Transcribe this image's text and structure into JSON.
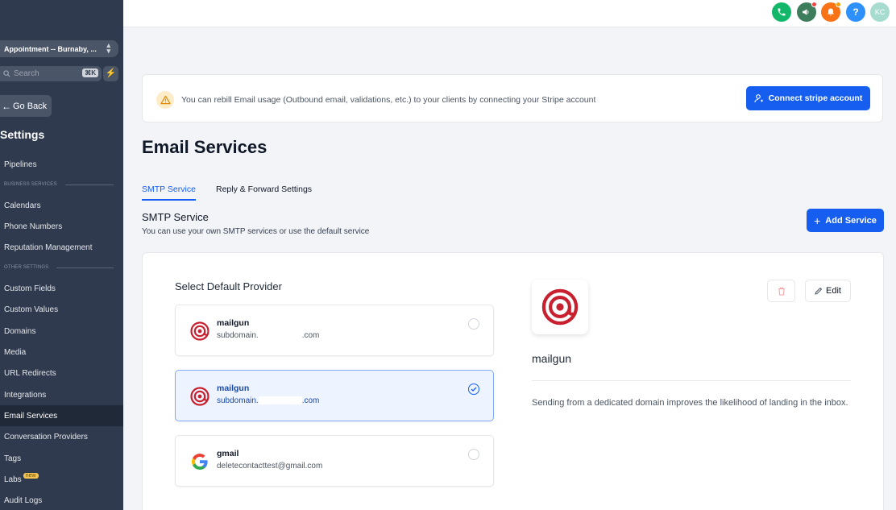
{
  "sidebar": {
    "location": "Appointment -- Burnaby, ...",
    "search_placeholder": "Search",
    "search_shortcut": "⌘K",
    "go_back": "Go Back",
    "settings_title": "Settings",
    "pipelines": "Pipelines",
    "business_section": "BUSINESS SERVICES",
    "calendars": "Calendars",
    "phone_numbers": "Phone Numbers",
    "reputation": "Reputation Management",
    "other_section": "OTHER SETTINGS",
    "custom_fields": "Custom Fields",
    "custom_values": "Custom Values",
    "domains": "Domains",
    "media": "Media",
    "url_redirects": "URL Redirects",
    "integrations": "Integrations",
    "email_services": "Email Services",
    "conversation_providers": "Conversation Providers",
    "tags": "Tags",
    "labs": "Labs",
    "labs_badge": "new",
    "audit_logs": "Audit Logs"
  },
  "topbar": {
    "avatar_initials": "KC",
    "help_label": "?"
  },
  "banner": {
    "text": "You can rebill Email usage (Outbound email, validations, etc.) to your clients by connecting your Stripe account",
    "button": "Connect stripe account"
  },
  "page": {
    "title": "Email Services",
    "tabs": [
      "SMTP Service",
      "Reply & Forward Settings"
    ],
    "section_title": "SMTP Service",
    "section_subtitle": "You can use your own SMTP services or use the default service",
    "add_button": "Add Service"
  },
  "card": {
    "select_title": "Select Default Provider",
    "providers": [
      {
        "name": "mailgun",
        "domain_prefix": "subdomain.",
        "domain_suffix": ".com",
        "selected": false
      },
      {
        "name": "mailgun",
        "domain_prefix": "subdomain.",
        "domain_suffix": ".com",
        "selected": true
      },
      {
        "name": "gmail",
        "domain_prefix": "deletecontacttest@gmail.com",
        "domain_suffix": "",
        "selected": false
      }
    ],
    "detail_name": "mailgun",
    "detail_description": "Sending from a dedicated domain improves the likelihood of landing in the inbox.",
    "edit_label": "Edit"
  },
  "colors": {
    "primary": "#155eef",
    "sidebar": "#2f3a4e",
    "mailgun_red": "#c8202f"
  }
}
